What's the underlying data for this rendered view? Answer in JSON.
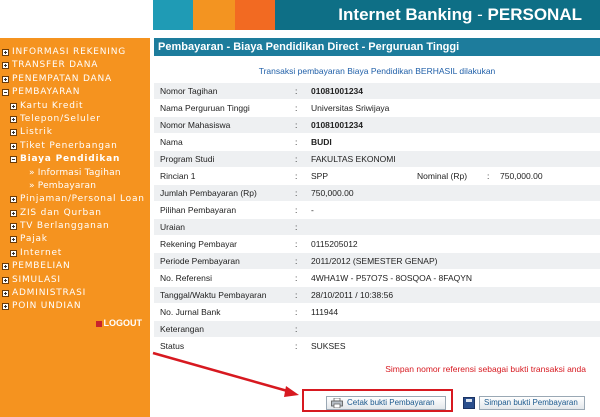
{
  "header": {
    "title_bold": "Internet Banking",
    "title_sep": " - ",
    "title_thin": "PERSONAL"
  },
  "colors": {
    "header_teal": "#0e6f86",
    "sidebar_orange": "#f5931f",
    "titlebar_blue": "#1d7c9c",
    "note_red": "#d71920",
    "highlight_red": "#d71920"
  },
  "sidebar": {
    "items": [
      {
        "label": "INFORMASI REKENING",
        "level": 0,
        "icon": "plus"
      },
      {
        "label": "TRANSFER DANA",
        "level": 0,
        "icon": "plus"
      },
      {
        "label": "PENEMPATAN DANA",
        "level": 0,
        "icon": "plus"
      },
      {
        "label": "PEMBAYARAN",
        "level": 0,
        "icon": "minus"
      },
      {
        "label": "Kartu Kredit",
        "level": 1,
        "icon": "plus"
      },
      {
        "label": "Telepon/Seluler",
        "level": 1,
        "icon": "plus"
      },
      {
        "label": "Listrik",
        "level": 1,
        "icon": "plus"
      },
      {
        "label": "Tiket Penerbangan",
        "level": 1,
        "icon": "plus"
      },
      {
        "label": "Biaya Pendidikan",
        "level": 1,
        "icon": "minus",
        "active": true
      },
      {
        "label": "» Informasi Tagihan",
        "level": 2,
        "icon": "none"
      },
      {
        "label": "» Pembayaran",
        "level": 2,
        "icon": "none"
      },
      {
        "label": "Pinjaman/Personal Loan",
        "level": 1,
        "icon": "plus"
      },
      {
        "label": "ZIS dan Qurban",
        "level": 1,
        "icon": "plus"
      },
      {
        "label": "TV Berlangganan",
        "level": 1,
        "icon": "plus"
      },
      {
        "label": "Pajak",
        "level": 1,
        "icon": "plus"
      },
      {
        "label": "Internet",
        "level": 1,
        "icon": "plus"
      },
      {
        "label": "PEMBELIAN",
        "level": 0,
        "icon": "plus"
      },
      {
        "label": "SIMULASI",
        "level": 0,
        "icon": "plus"
      },
      {
        "label": "ADMINISTRASI",
        "level": 0,
        "icon": "plus"
      },
      {
        "label": "POIN UNDIAN",
        "level": 0,
        "icon": "plus"
      }
    ],
    "logout": "LOGOUT"
  },
  "main": {
    "title": "Pembayaran - Biaya Pendidikan Direct - Perguruan Tinggi",
    "success_message": "Transaksi pembayaran Biaya Pendidikan BERHASIL dilakukan",
    "rows": [
      {
        "label": "Nomor Tagihan",
        "value": "01081001234",
        "bold": true
      },
      {
        "label": "Nama Perguruan Tinggi",
        "value": "Universitas Sriwijaya"
      },
      {
        "label": "Nomor Mahasiswa",
        "value": "01081001234",
        "bold": true
      },
      {
        "label": "Nama",
        "value": "BUDI",
        "bold": true
      },
      {
        "label": "Program Studi",
        "value": "FAKULTAS EKONOMI"
      },
      {
        "label": "Rincian 1",
        "value": "SPP",
        "label2": "Nominal (Rp)",
        "value2": "750,000.00"
      },
      {
        "label": "Jumlah Pembayaran (Rp)",
        "value": "750,000.00"
      },
      {
        "label": "Pilihan Pembayaran",
        "value": "-"
      },
      {
        "label": "Uraian",
        "value": ""
      },
      {
        "label": "Rekening Pembayar",
        "value": "0115205012"
      },
      {
        "label": "Periode Pembayaran",
        "value": "2011/2012 (SEMESTER GENAP)"
      },
      {
        "label": "No. Referensi",
        "value": "4WHA1W - P57O7S - 8OSQOA - 8FAQYN"
      },
      {
        "label": "Tanggal/Waktu Pembayaran",
        "value": "28/10/2011 / 10:38:56"
      },
      {
        "label": "No. Jurnal Bank",
        "value": "111944"
      },
      {
        "label": "Keterangan",
        "value": ""
      },
      {
        "label": "Status",
        "value": "SUKSES"
      }
    ],
    "note": "Simpan nomor referensi sebagai bukti transaksi anda",
    "print_button": "Cetak bukti Pembayaran",
    "save_button": "Simpan bukti Pembayaran"
  }
}
